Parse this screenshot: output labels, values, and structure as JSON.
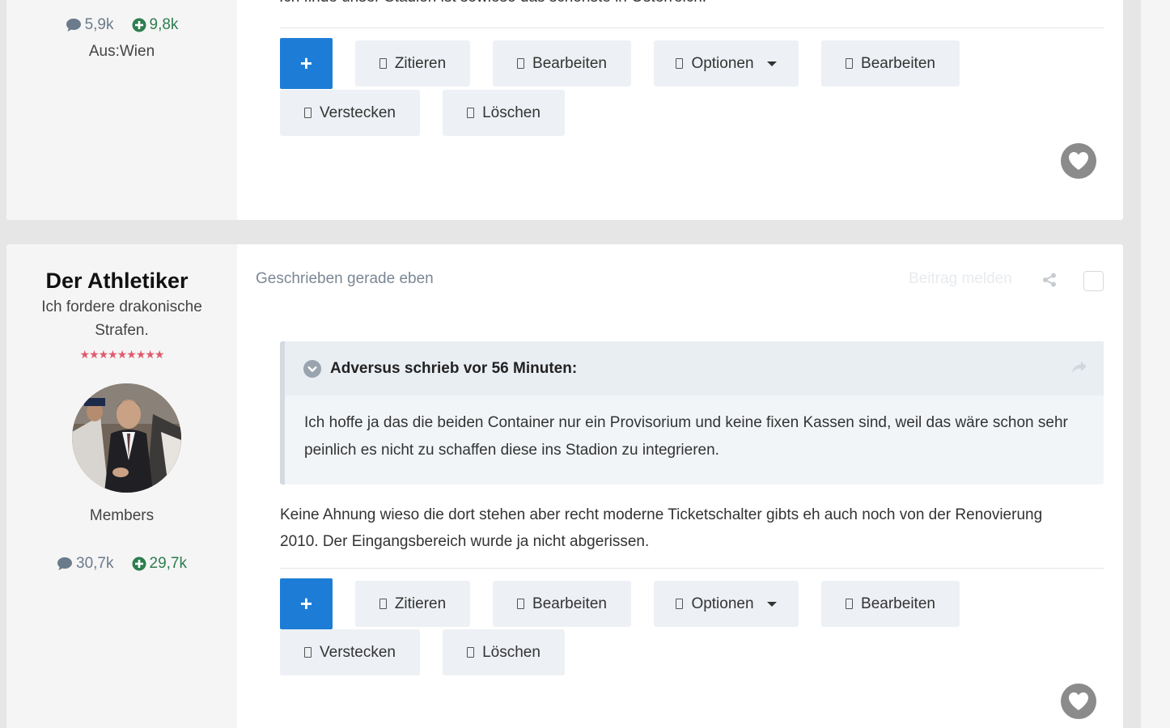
{
  "previous_post": {
    "text_tail": "Ich finde unser Stadion ist sowieso das schönste in Österreich.",
    "author": {
      "posts_count": "5,9k",
      "reputation": "9,8k",
      "location": "Aus:Wien"
    }
  },
  "post": {
    "author": {
      "name": "Der Athletiker",
      "title": "Ich fordere drakonische Strafen.",
      "title_line1": "Ich fordere drakonische",
      "title_line2": "Strafen.",
      "rank_stars": "★★★★★★★★★",
      "group": "Members",
      "posts_count": "30,7k",
      "reputation": "29,7k"
    },
    "written": "Geschrieben gerade eben",
    "report_label": "Beitrag melden",
    "quote": {
      "citation": "Adversus schrieb vor 56 Minuten:",
      "text": "Ich hoffe ja das die beiden Container nur ein Provisorium und keine fixen Kassen sind, weil das wäre schon sehr peinlich es nicht zu schaffen diese ins Stadion zu integrieren."
    },
    "body": "Keine Ahnung wieso die dort stehen aber recht moderne Ticketschalter gibts eh auch noch von der Renovierung 2010. Der Eingangsbereich wurde ja nicht abgerissen."
  },
  "actions": {
    "plus": "+",
    "quote": "Zitieren",
    "edit": "Bearbeiten",
    "options": "Optionen",
    "edit2": "Bearbeiten",
    "hide": "Verstecken",
    "delete": "Löschen"
  },
  "colors": {
    "accent": "#1d7dd6",
    "reputation": "#2e7d4f",
    "stat_gray": "#6b7b8c"
  }
}
